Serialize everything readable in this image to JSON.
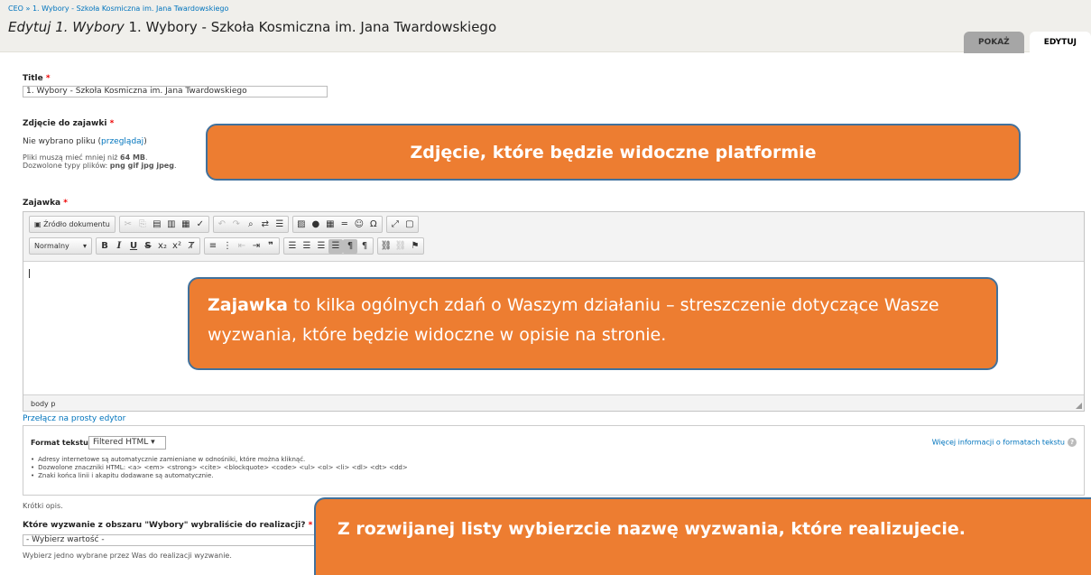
{
  "breadcrumb": [
    "CEO",
    "1. Wybory - Szkoła Kosmiczna im. Jana Twardowskiego"
  ],
  "breadcrumb_sep": "»",
  "page_title": {
    "prefix": "Edytuj 1. Wybory",
    "rest": " 1. Wybory - Szkoła Kosmiczna im. Jana Twardowskiego"
  },
  "tabs": {
    "show": "POKAŻ",
    "edit": "EDYTUJ"
  },
  "title_field": {
    "label": "Title",
    "required": "*",
    "value": "1. Wybory - Szkoła Kosmiczna im. Jana Twardowskiego"
  },
  "image_field": {
    "label": "Zdjęcie do zajawki",
    "required": "*",
    "no_file": "Nie wybrano pliku",
    "browse": "przeglądaj",
    "size_note_pre": "Pliki muszą mieć mniej niż",
    "size_value": "64 MB",
    "types_note_pre": "Dozwolone typy plików:",
    "types_value": "png gif jpg jpeg"
  },
  "teaser_field": {
    "label": "Zajawka",
    "required": "*"
  },
  "editor": {
    "source_label": "Źródło dokumentu",
    "format_combo": "Normalny",
    "elementpath": "body  p",
    "switch_link": "Przełącz na prosty edytor"
  },
  "text_format": {
    "label": "Format tekstu",
    "selected": "Filtered HTML",
    "more_info": "Więcej informacji o formatach tekstu",
    "tips": [
      "Adresy internetowe są automatycznie zamieniane w odnośniki, które można kliknąć.",
      "Dozwolone znaczniki HTML: <a> <em> <strong> <cite> <blockquote> <code> <ul> <ol> <li> <dl> <dt> <dd>",
      "Znaki końca linii i akapitu dodawane są automatycznie."
    ]
  },
  "short_desc": "Krótki opis.",
  "challenge_field": {
    "label": "Które wyzwanie z obszaru \"Wybory\" wybraliście do realizacji?",
    "required": "*",
    "value": "- Wybierz wartość -",
    "description": "Wybierz jedno wybrane przez Was do realizacji wyzwanie."
  },
  "callouts": {
    "image": "Zdjęcie, które będzie widoczne platformie",
    "teaser_bold": "Zajawka",
    "teaser_rest": " to kilka ogólnych zdań o Waszym działaniu – streszczenie dotyczące Wasze wyzwania, które będzie widoczne w opisie na stronie.",
    "select": "Z rozwijanej listy wybierzcie nazwę wyzwania, które realizujecie."
  },
  "colors": {
    "callout": "#ed7d31",
    "callout_border": "#41719c",
    "link": "#0074bd"
  }
}
